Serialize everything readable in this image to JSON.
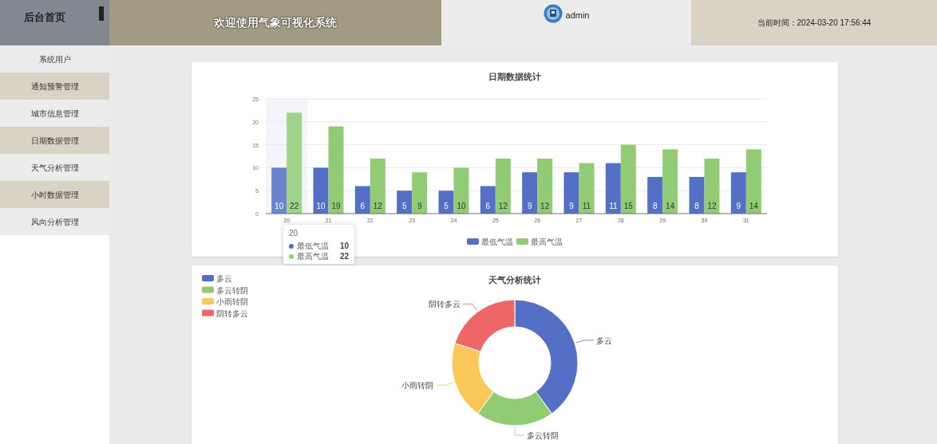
{
  "sidebar": {
    "title": "后台首页",
    "items": [
      {
        "label": "系统用户",
        "selected": false
      },
      {
        "label": "通知预警管理",
        "selected": false
      },
      {
        "label": "城市信息管理",
        "selected": false
      },
      {
        "label": "日期数据管理",
        "selected": false
      },
      {
        "label": "天气分析管理",
        "selected": false
      },
      {
        "label": "小时数据管理",
        "selected": false
      },
      {
        "label": "风向分析管理",
        "selected": false
      }
    ]
  },
  "header": {
    "title": "欢迎使用气象可视化系统",
    "user": "admin",
    "time": "当前时间：2024-03-20 17:56:44"
  },
  "date_chart": {
    "chart_data": {
      "type": "bar",
      "title": "日期数据统计",
      "categories": [
        "20",
        "21",
        "22",
        "23",
        "24",
        "25",
        "26",
        "27",
        "28",
        "29",
        "30",
        "31"
      ],
      "yticks": [
        0,
        5,
        10,
        15,
        20,
        25
      ],
      "ylim": [
        0,
        25
      ],
      "data_labels": true,
      "grid": true,
      "legend": true,
      "bands": [
        {
          "axis": "x",
          "from": "20",
          "to": "20"
        }
      ],
      "series": [
        {
          "name": "最低气温",
          "color": "#5470c6",
          "values": [
            10,
            10,
            6,
            5,
            5,
            6,
            9,
            9,
            11,
            8,
            8,
            9
          ]
        },
        {
          "name": "最高气温",
          "color": "#91cc75",
          "values": [
            22,
            19,
            12,
            9,
            10,
            12,
            12,
            11,
            15,
            14,
            12,
            14
          ]
        }
      ]
    },
    "tooltip": {
      "title": "20",
      "rows": [
        {
          "name": "最低气温",
          "value": "10",
          "color": "#5470c6"
        },
        {
          "name": "最高气温",
          "value": "22",
          "color": "#91cc75"
        }
      ]
    }
  },
  "weather_chart": {
    "chart_data": {
      "type": "donut",
      "title": "天气分析统计",
      "categories": [
        "多云",
        "多云转阴",
        "小雨转阴",
        "阴转多云"
      ],
      "legend": true,
      "values": [
        40,
        20,
        20,
        20
      ]
    }
  }
}
